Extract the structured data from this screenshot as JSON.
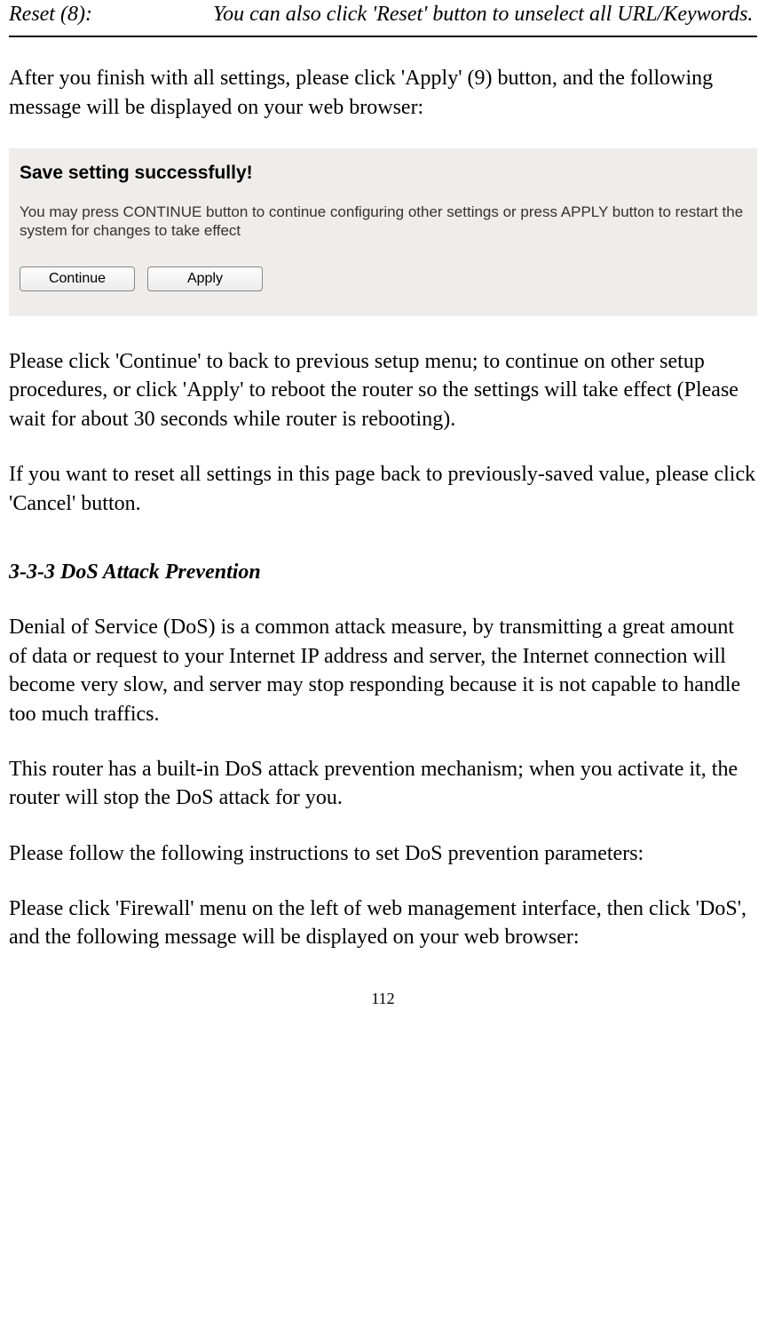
{
  "header": {
    "label": "Reset (8):",
    "desc": "You can also click 'Reset' button to unselect all URL/Keywords."
  },
  "para1": "After you finish with all settings, please click 'Apply' (9) button, and the following message will be displayed on your web browser:",
  "screenshot": {
    "title": "Save setting successfully!",
    "text": "You may press CONTINUE button to continue configuring other settings or press APPLY button to restart the system for changes to take effect",
    "continue_label": "Continue",
    "apply_label": "Apply"
  },
  "para2": "Please click 'Continue' to back to previous setup menu; to continue on other setup procedures, or click 'Apply' to reboot the router so the settings will take effect (Please wait for about 30 seconds while router is rebooting).",
  "para3": "If you want to reset all settings in this page back to previously-saved value, please click 'Cancel' button.",
  "section_heading": "3-3-3 DoS Attack Prevention",
  "para4": "Denial of Service (DoS) is a common attack measure, by transmitting a great amount of data or request to your Internet IP address and server, the Internet connection will become very slow, and server may stop responding because it is not capable to handle too much traffics.",
  "para5": "This router has a built-in DoS attack prevention mechanism; when you activate it, the router will stop the DoS attack for you.",
  "para6": "Please follow the following instructions to set DoS prevention parameters:",
  "para7": "Please click 'Firewall' menu on the left of web management interface, then click 'DoS', and the following message will be displayed on your web browser:",
  "page_number": "112"
}
